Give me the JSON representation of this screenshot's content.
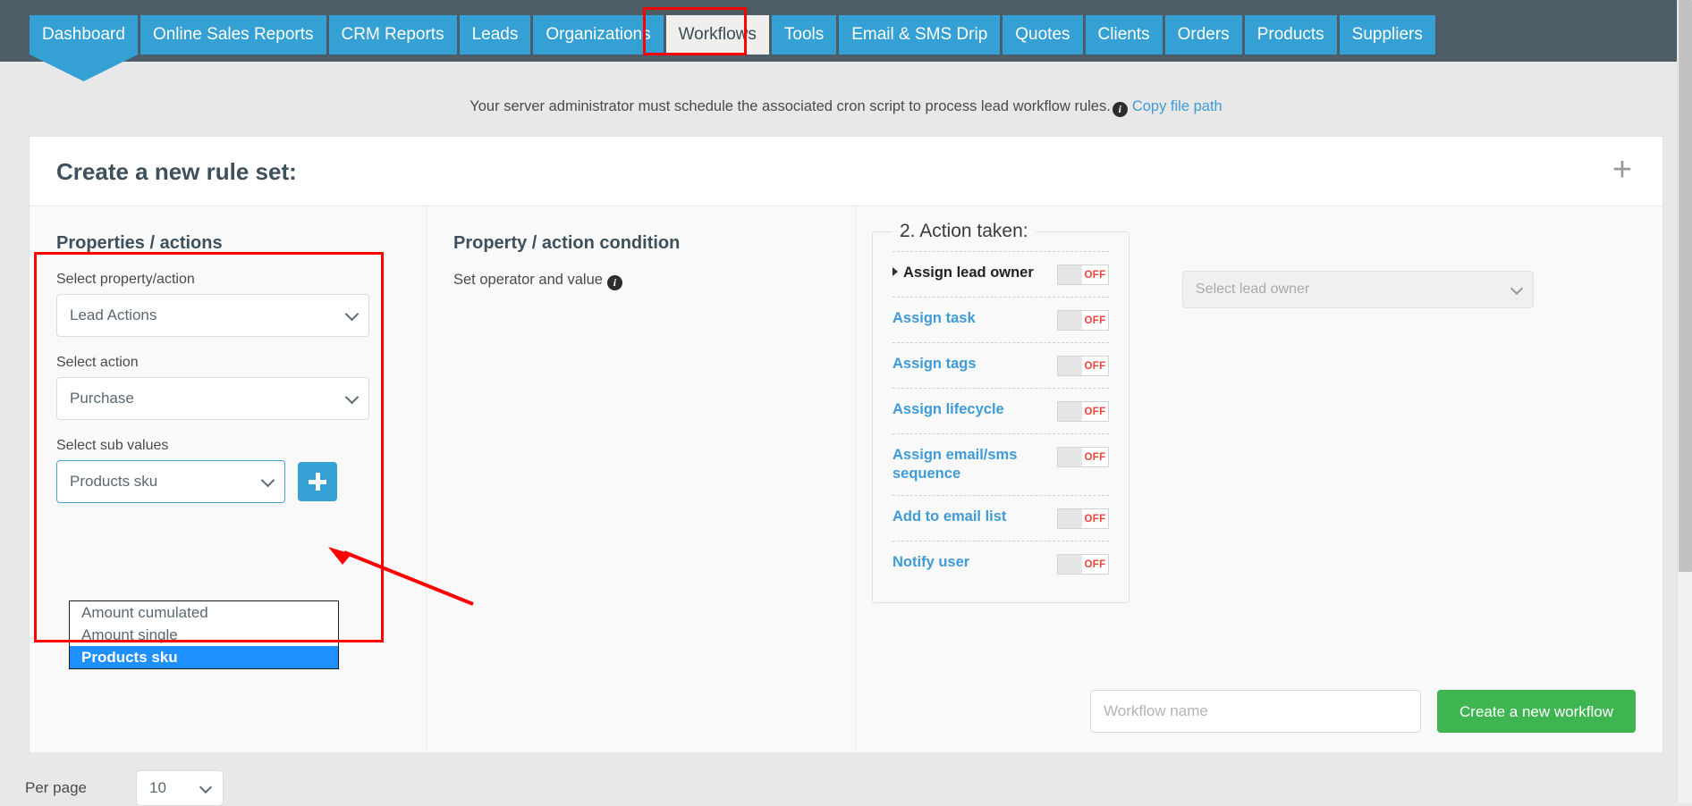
{
  "nav": {
    "tabs": [
      {
        "label": "Dashboard",
        "active": false,
        "first": true
      },
      {
        "label": "Online Sales Reports",
        "active": false
      },
      {
        "label": "CRM Reports",
        "active": false
      },
      {
        "label": "Leads",
        "active": false
      },
      {
        "label": "Organizations",
        "active": false
      },
      {
        "label": "Workflows",
        "active": true
      },
      {
        "label": "Tools",
        "active": false
      },
      {
        "label": "Email & SMS Drip",
        "active": false
      },
      {
        "label": "Quotes",
        "active": false
      },
      {
        "label": "Clients",
        "active": false
      },
      {
        "label": "Orders",
        "active": false
      },
      {
        "label": "Products",
        "active": false
      },
      {
        "label": "Suppliers",
        "active": false
      }
    ]
  },
  "notice": {
    "text": "Your server administrator must schedule the associated cron script to process lead workflow rules.",
    "info_icon": "i",
    "link_label": "Copy file path"
  },
  "card": {
    "title": "Create a new rule set:",
    "add_icon": "+"
  },
  "properties_panel": {
    "heading": "Properties / actions",
    "property_label": "Select property/action",
    "property_value": "Lead Actions",
    "action_label": "Select action",
    "action_value": "Purchase",
    "subvalues_label": "Select sub values",
    "subvalues_value": "Products sku",
    "add_button_icon": "plus-icon",
    "dropdown_options": [
      {
        "label": "Amount cumulated",
        "selected": false
      },
      {
        "label": "Amount single",
        "selected": false
      },
      {
        "label": "Products sku",
        "selected": true
      }
    ]
  },
  "condition_panel": {
    "heading": "Property / action condition",
    "subtext": "Set operator and value",
    "info_icon": "i"
  },
  "action_panel": {
    "legend": "2. Action taken:",
    "rows": [
      {
        "label": "Assign lead owner",
        "state": "OFF",
        "expandable": true,
        "dark": true
      },
      {
        "label": "Assign task",
        "state": "OFF",
        "expandable": false,
        "dark": false
      },
      {
        "label": "Assign tags",
        "state": "OFF",
        "expandable": false,
        "dark": false
      },
      {
        "label": "Assign lifecycle",
        "state": "OFF",
        "expandable": false,
        "dark": false
      },
      {
        "label": "Assign email/sms sequence",
        "state": "OFF",
        "expandable": false,
        "dark": false
      },
      {
        "label": "Add to email list",
        "state": "OFF",
        "expandable": false,
        "dark": false
      },
      {
        "label": "Notify user",
        "state": "OFF",
        "expandable": false,
        "dark": false
      }
    ],
    "lead_owner_placeholder": "Select lead owner"
  },
  "footer_form": {
    "workflow_name_placeholder": "Workflow name",
    "create_button_label": "Create a new workflow"
  },
  "footer": {
    "per_page_label": "Per page",
    "per_page_value": "10"
  },
  "colors": {
    "nav_bg": "#4c5d68",
    "tab_blue": "#35a0d4",
    "link_blue": "#3e9bd6",
    "green": "#3eb551",
    "highlight_red": "#ff0000",
    "toggle_off_red": "#e8443c",
    "dropdown_selected": "#1e90ff"
  }
}
